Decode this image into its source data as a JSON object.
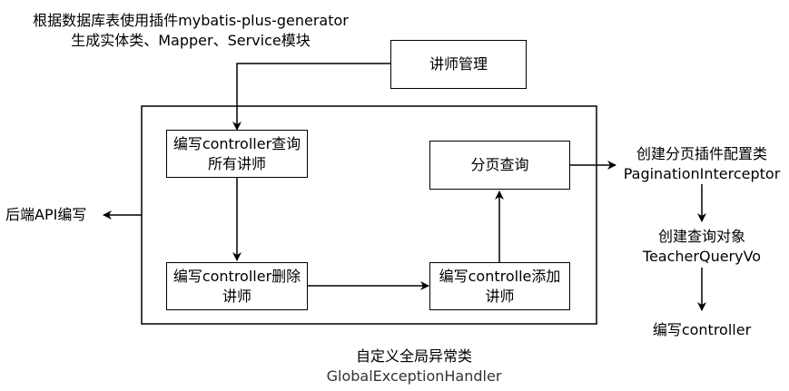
{
  "top_note": {
    "line1": "根据数据库表使用插件mybatis-plus-generator",
    "line2": "生成实体类、Mapper、Service模块"
  },
  "teacher_mgmt": "讲师管理",
  "boxes": {
    "query_all": {
      "line1": "编写controller查询",
      "line2": "所有讲师"
    },
    "delete": {
      "line1": "编写controller删除",
      "line2": "讲师"
    },
    "add": {
      "line1": "编写controlle添加",
      "line2": "讲师"
    },
    "page_query": "分页查询"
  },
  "left_label": "后端API编写",
  "bottom_note": {
    "line1": "自定义全局异常类",
    "line2": "GlobalExceptionHandler"
  },
  "right_flow": {
    "step1": {
      "line1": "创建分页插件配置类",
      "line2": "PaginationInterceptor"
    },
    "step2": {
      "line1": "创建查询对象",
      "line2": "TeacherQueryVo"
    },
    "step3": "编写controller"
  }
}
